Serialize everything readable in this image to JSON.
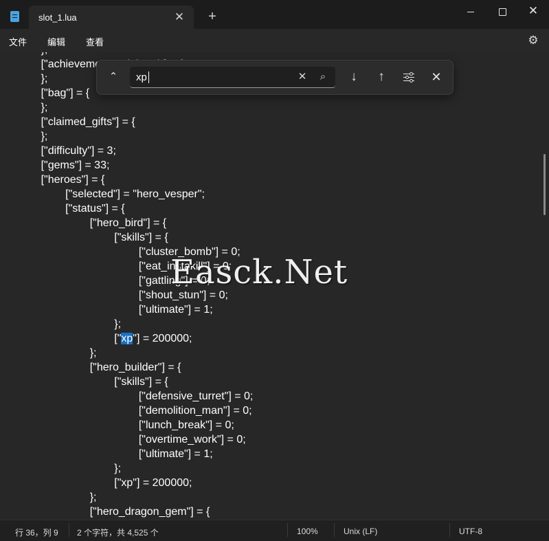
{
  "titlebar": {
    "tab_title": "slot_1.lua",
    "tab_close_glyph": "✕",
    "new_tab_glyph": "+",
    "close_glyph": "✕"
  },
  "menu": {
    "items": [
      "文件",
      "编辑",
      "查看"
    ]
  },
  "find": {
    "query": "xp",
    "clear_glyph": "✕",
    "search_glyph": "⌕",
    "next_glyph": "↓",
    "prev_glyph": "↑",
    "close_glyph": "✕",
    "collapse_glyph": "⌃"
  },
  "editor": {
    "lines": [
      "        },",
      "        [\"achievements_claimed\"] = {",
      "        };",
      "        [\"bag\"] = {",
      "        };",
      "        [\"claimed_gifts\"] = {",
      "        };",
      "        [\"difficulty\"] = 3;",
      "        [\"gems\"] = 33;",
      "        [\"heroes\"] = {",
      "                [\"selected\"] = \"hero_vesper\";",
      "                [\"status\"] = {",
      "                        [\"hero_bird\"] = {",
      "                                [\"skills\"] = {",
      "                                        [\"cluster_bomb\"] = 0;",
      "                                        [\"eat_instakill\"] = 0;",
      "                                        [\"gattling\"] = 0;",
      "                                        [\"shout_stun\"] = 0;",
      "                                        [\"ultimate\"] = 1;",
      "                                };",
      "                                [\"xp\"] = 200000;",
      "                        };",
      "                        [\"hero_builder\"] = {",
      "                                [\"skills\"] = {",
      "                                        [\"defensive_turret\"] = 0;",
      "                                        [\"demolition_man\"] = 0;",
      "                                        [\"lunch_break\"] = 0;",
      "                                        [\"overtime_work\"] = 0;",
      "                                        [\"ultimate\"] = 1;",
      "                                };",
      "                                [\"xp\"] = 200000;",
      "                        };",
      "                        [\"hero_dragon_gem\"] = {"
    ],
    "highlighted_line": {
      "before": "                                [\"",
      "match": "xp",
      "after": "\"] = 200000;"
    }
  },
  "watermark": "Easck.Net",
  "status": {
    "position": "行 36，列 9",
    "chars": "2 个字符，共 4,525 个",
    "zoom": "100%",
    "line_ending": "Unix (LF)",
    "encoding": "UTF-8"
  },
  "colors": {
    "background": "#202020",
    "editor": "#272727",
    "highlight": "#1a6fc4",
    "icon_blue": "#4aa3e0"
  },
  "icons": {
    "app": "notepad-icon",
    "settings": "gear-icon"
  }
}
